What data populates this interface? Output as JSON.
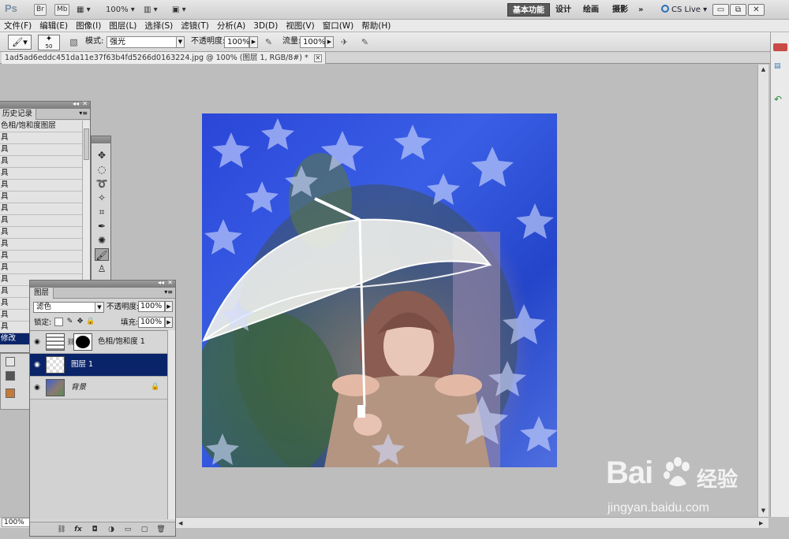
{
  "app": {
    "logo": "Ps",
    "bridge": "Br",
    "minibridge": "Mb",
    "zoom_select": "100%",
    "workspaces": [
      "基本功能",
      "设计",
      "绘画",
      "摄影"
    ],
    "more": "»",
    "cs_live": "CS Live",
    "win_min": "▭",
    "win_restore": "⧉",
    "win_close": "✕"
  },
  "menu": [
    "文件(F)",
    "编辑(E)",
    "图像(I)",
    "图层(L)",
    "选择(S)",
    "滤镜(T)",
    "分析(A)",
    "3D(D)",
    "视图(V)",
    "窗口(W)",
    "帮助(H)"
  ],
  "options": {
    "brush_size": "50",
    "mode_label": "模式:",
    "mode_value": "强光",
    "opacity_label": "不透明度:",
    "opacity_value": "100%",
    "flow_label": "流量:",
    "flow_value": "100%"
  },
  "document": {
    "tab_title": "1ad5ad6eddc451da11e37f63b4fd5266d0163224.jpg @ 100% (图层 1, RGB/8#) *",
    "status_zoom": "100%"
  },
  "history": {
    "tab": "历史记录",
    "rows": [
      "色相/饱和度图层",
      "具",
      "具",
      "具",
      "具",
      "具",
      "具",
      "具",
      "具",
      "具",
      "具",
      "具",
      "具",
      "具",
      "具",
      "具",
      "具",
      "具",
      "修改"
    ],
    "selected_index": 18
  },
  "layers": {
    "tab": "图层",
    "blend_mode": "滤色",
    "opacity_label": "不透明度:",
    "opacity_value": "100%",
    "lock_label": "锁定:",
    "fill_label": "填充:",
    "fill_value": "100%",
    "items": [
      {
        "name": "色相/饱和度 1",
        "type": "adjustment"
      },
      {
        "name": "图层 1",
        "type": "layer",
        "selected": true
      },
      {
        "name": "背景",
        "type": "background",
        "locked": true
      }
    ]
  },
  "watermark": {
    "brand": "Bai",
    "brand_suffix": "经验",
    "url": "jingyan.baidu.com"
  },
  "colors": {
    "selection": "#0a246a",
    "accent_blue": "#2a46d8",
    "panel_bg": "#d6d6d6"
  },
  "icons": [
    "move-icon",
    "marquee-icon",
    "lasso-icon",
    "magic-wand-icon",
    "crop-icon",
    "eyedropper-icon",
    "healing-icon",
    "brush-icon",
    "stamp-icon",
    "eye-icon",
    "lock-icon",
    "link-icon",
    "fx-icon",
    "mask-icon",
    "adjustment-icon",
    "folder-icon",
    "new-layer-icon",
    "trash-icon"
  ]
}
